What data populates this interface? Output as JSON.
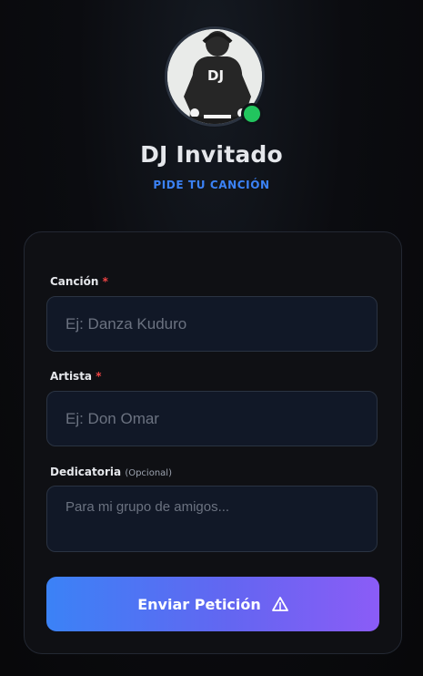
{
  "header": {
    "title": "DJ Invitado",
    "subtitle": "PIDE TU CANCIÓN",
    "avatar_shirt_text": "DJ",
    "status": "online",
    "status_color": "#22c55e"
  },
  "form": {
    "song": {
      "label": "Canción",
      "required_mark": "*",
      "placeholder": "Ej: Danza Kuduro",
      "value": ""
    },
    "artist": {
      "label": "Artista",
      "required_mark": "*",
      "placeholder": "Ej: Don Omar",
      "value": ""
    },
    "dedication": {
      "label": "Dedicatoria",
      "optional_note": "(Opcional)",
      "placeholder": "Para mi grupo de amigos...",
      "value": ""
    },
    "submit": {
      "label": "Enviar Petición",
      "icon": "send-triangle-icon"
    }
  },
  "colors": {
    "accent_blue": "#3b82f6",
    "accent_purple": "#8b5cf6",
    "required_red": "#ef4444"
  }
}
